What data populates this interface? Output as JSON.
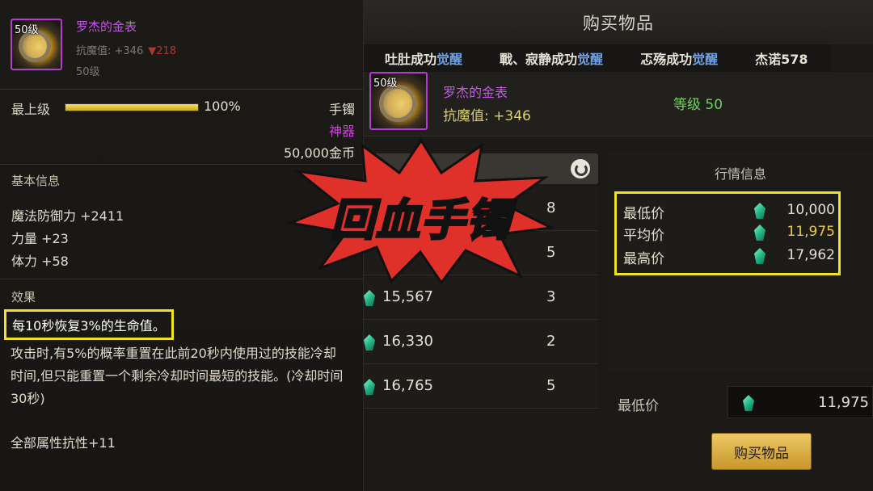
{
  "tooltip": {
    "level_badge": "50级",
    "item_name": "罗杰的金表",
    "resist_label": "抗魔值: +346",
    "resist_delta": "▼218",
    "level_text": "50级",
    "grade_label": "最上级",
    "grade_progress": 1.0,
    "grade_pct": "100%",
    "item_type": "手镯",
    "rarity": "神器",
    "sell_price": "50,000金币",
    "basic_info_heading": "基本信息",
    "stats": [
      "魔法防御力 +2411",
      "力量 +23",
      "体力 +58"
    ],
    "effect_heading": "效果",
    "effect_highlight": "每10秒恢复3%的生命值。",
    "effect_desc": "攻击时,有5%的概率重置在此前20秒内使用过的技能冷却时间,但只能重置一个剩余冷却时间最短的技能。(冷却时间30秒)",
    "all_resist": "全部属性抗性+11"
  },
  "shop": {
    "title": "购买物品",
    "ticker": [
      {
        "text": "吐肚成功",
        "hl": "觉醒"
      },
      {
        "text": "戰、寂静成功",
        "hl": "觉醒"
      },
      {
        "text": "忑殇成功",
        "hl": "觉醒"
      },
      {
        "text": "杰诺578",
        "hl": ""
      }
    ],
    "item_level_badge": "50级",
    "item_name": "罗杰的金表",
    "item_resist": "抗魔值: +346",
    "item_level": "等级 50",
    "listings": [
      {
        "price": "",
        "qty": "8"
      },
      {
        "price": "",
        "qty": "5"
      },
      {
        "price": "15,567",
        "qty": "3"
      },
      {
        "price": "16,330",
        "qty": "2"
      },
      {
        "price": "16,765",
        "qty": "5"
      }
    ],
    "market": {
      "title": "行情信息",
      "rows": [
        {
          "label": "最低价",
          "value": "10,000"
        },
        {
          "label": "平均价",
          "value": "11,975"
        },
        {
          "label": "最高价",
          "value": "17,962"
        }
      ]
    },
    "bottom_label": "最低价",
    "bottom_value": "11,975",
    "buy_button": "购买物品"
  },
  "overlay": {
    "caption": "回血手镯"
  },
  "colors": {
    "highlight_frame": "#f2e21f",
    "epic_purple": "#c35ae6",
    "gem_green": "#27b98a",
    "burst_red": "#e0302a"
  }
}
